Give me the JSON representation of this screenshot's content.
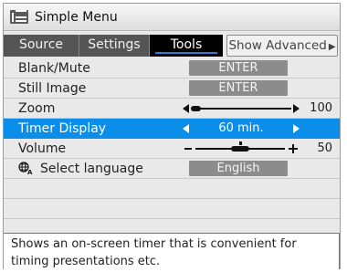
{
  "window": {
    "title": "Simple Menu",
    "icon": "menu-list-icon"
  },
  "tabs": [
    {
      "label": "Source"
    },
    {
      "label": "Settings"
    },
    {
      "label": "Tools",
      "active": true
    },
    {
      "label": "Show Advanced"
    }
  ],
  "rows": {
    "blank_mute": {
      "label": "Blank/Mute",
      "button": "ENTER"
    },
    "still_image": {
      "label": "Still Image",
      "button": "ENTER"
    },
    "zoom": {
      "label": "Zoom",
      "value": "100",
      "level": 0.1
    },
    "timer_display": {
      "label": "Timer Display",
      "value": "60 min.",
      "selected": true
    },
    "volume": {
      "label": "Volume",
      "value": "50",
      "level": 0.5
    },
    "select_language": {
      "label": "Select language",
      "button": "English",
      "icon": "language-globe-icon"
    }
  },
  "description": {
    "line1": "Shows an on-screen timer that is convenient for",
    "line2": "timing presentations etc."
  },
  "colors": {
    "selection": "#0a8eea",
    "active_tab": "#000000",
    "tab_underline": "#2d7ed8",
    "button": "#8c8c8c"
  }
}
